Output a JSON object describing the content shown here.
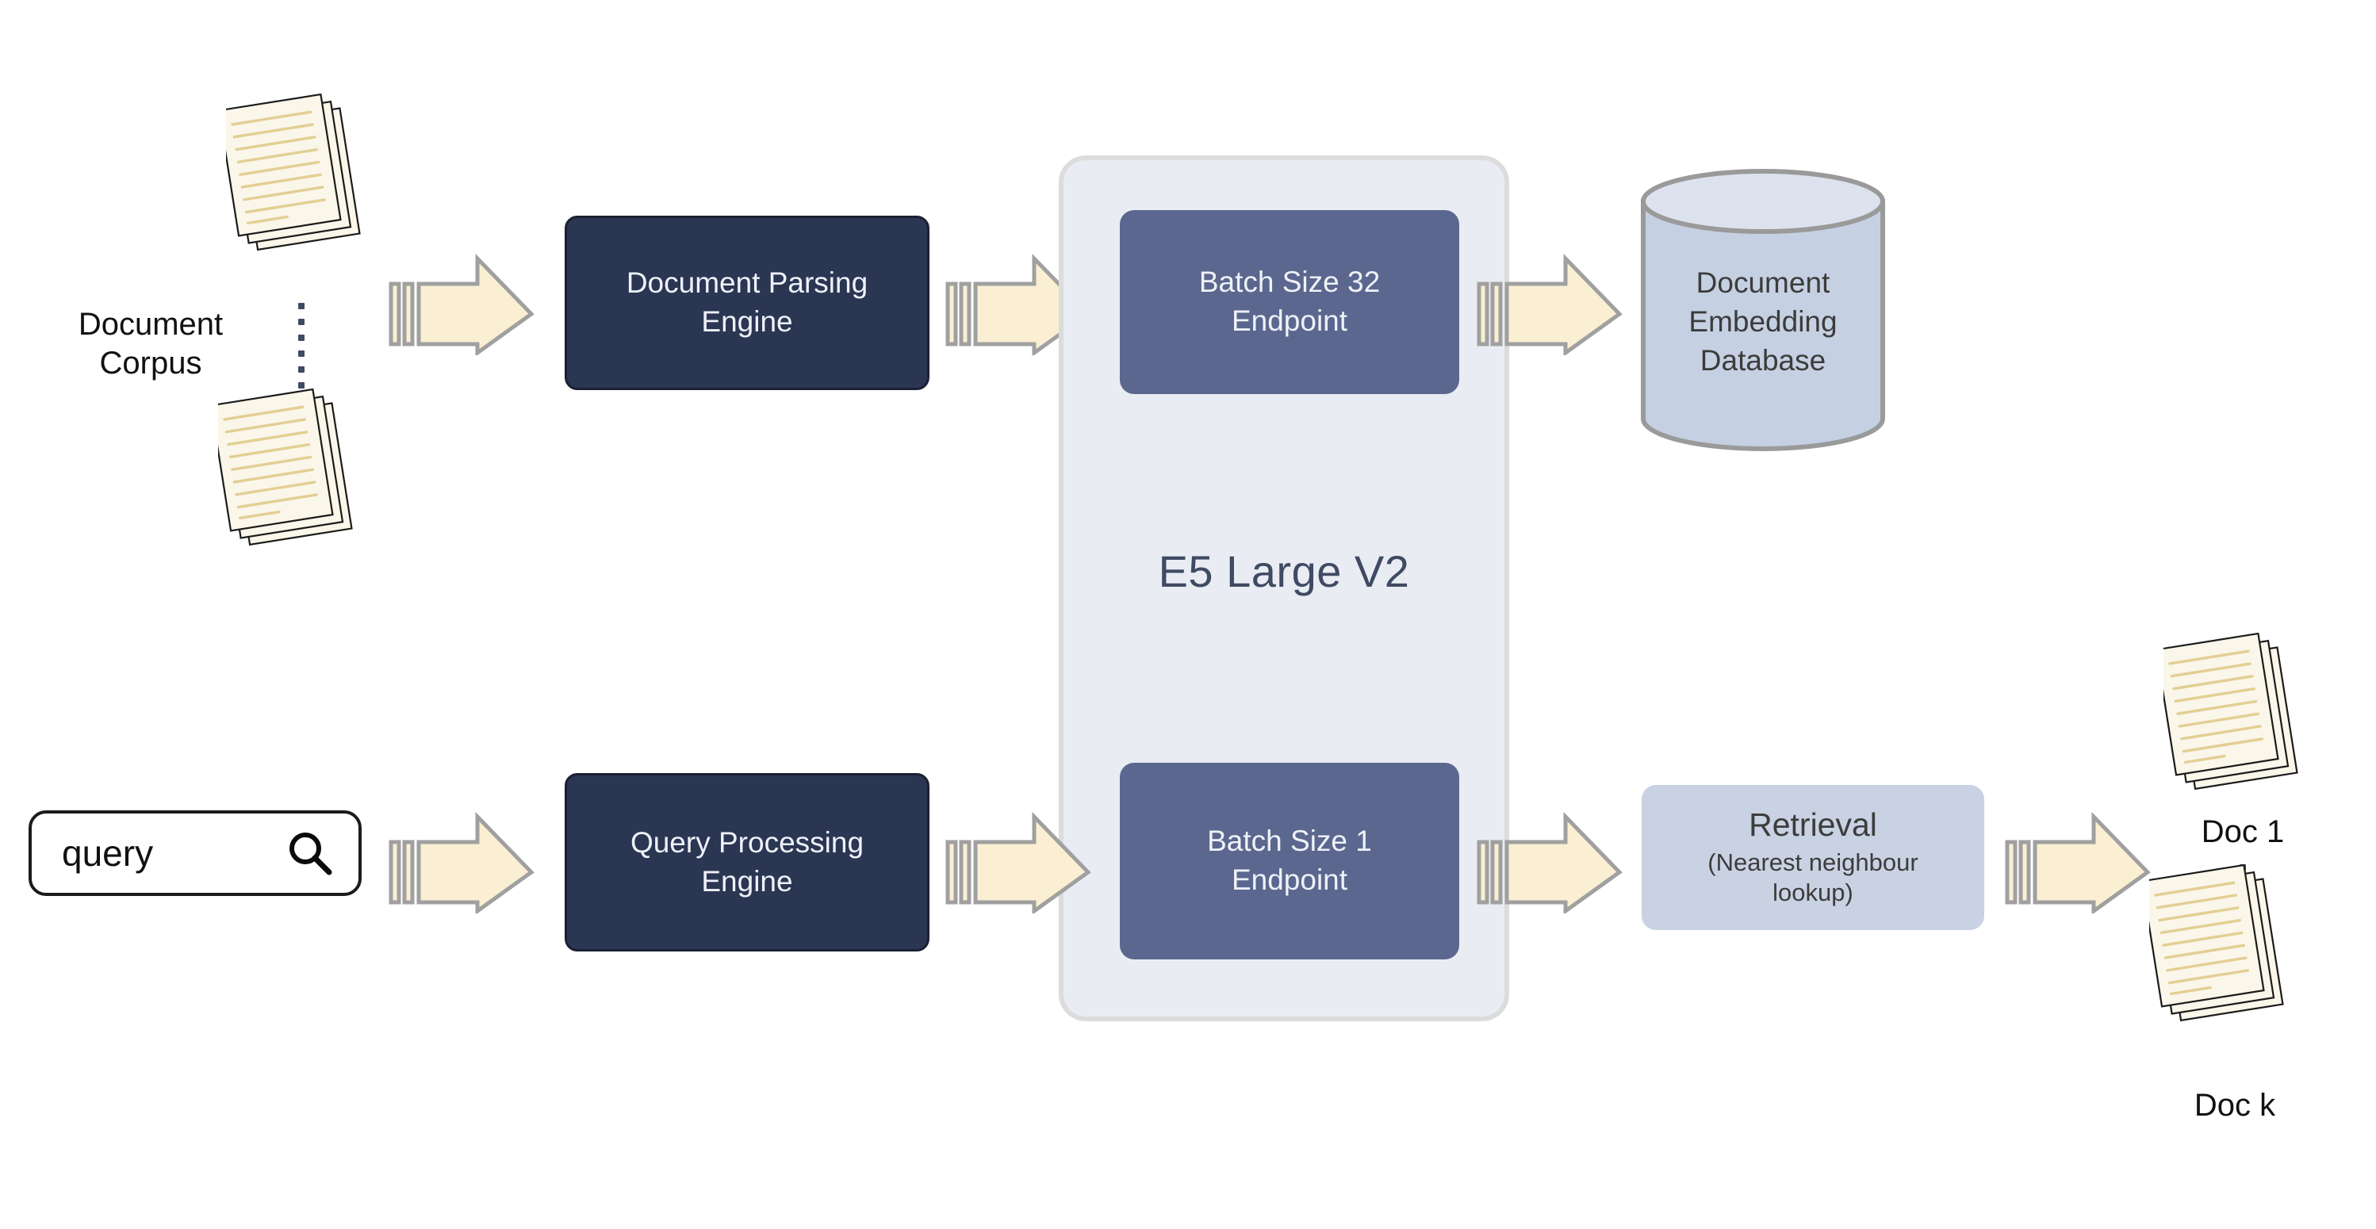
{
  "diagram": {
    "title": "E5 Large V2 document and query embedding retrieval pipeline",
    "colors": {
      "engine_box_fill": "#2b3653",
      "endpoint_box_fill": "#5b678e",
      "panel_fill": "#e9ecf2",
      "panel_border": "#dcdcdc",
      "cylinder_fill": "#c5d0e2",
      "cylinder_top_fill": "#dde3ee",
      "cylinder_border": "#9a9a9a",
      "retrieval_fill": "#c8d2e3",
      "arrow_fill": "#faefd2",
      "arrow_border": "#a0a0a0",
      "document_fill": "#faf6e9",
      "document_line": "#e2cf93",
      "document_border": "#1b1b1b",
      "text_dark": "#111111",
      "text_light": "#eef1f7",
      "e5_title_color": "#3f4a63"
    }
  },
  "corpus": {
    "label": "Document\nCorpus",
    "label_line_1": "Document",
    "label_line_2": "Corpus",
    "top_stack_name": "document-stack",
    "bottom_stack_name": "document-stack",
    "ellipsis": "vertical-dots"
  },
  "search": {
    "value": "query",
    "placeholder": "query",
    "icon": "search-icon"
  },
  "engines": {
    "document_parsing": {
      "line_1": "Document Parsing",
      "line_2": "Engine"
    },
    "query_processing": {
      "line_1": "Query Processing",
      "line_2": "Engine"
    }
  },
  "model_panel": {
    "title": "E5 Large V2",
    "endpoints": [
      {
        "line_1": "Batch Size 32",
        "line_2": "Endpoint"
      },
      {
        "line_1": "Batch Size 1",
        "line_2": "Endpoint"
      }
    ]
  },
  "database": {
    "line_1": "Document",
    "line_2": "Embedding",
    "line_3": "Database",
    "shape": "cylinder"
  },
  "retrieval": {
    "title": "Retrieval",
    "subtitle_line_1": "(Nearest neighbour",
    "subtitle_line_2": "lookup)"
  },
  "results": {
    "first_label": "Doc 1",
    "last_label": "Doc k",
    "ellipsis": "vertical-dots"
  },
  "arrows": [
    {
      "name": "arrow-corpus-to-parsing"
    },
    {
      "name": "arrow-parsing-to-batch32"
    },
    {
      "name": "arrow-batch32-to-database"
    },
    {
      "name": "arrow-query-to-processing"
    },
    {
      "name": "arrow-processing-to-batch1"
    },
    {
      "name": "arrow-batch1-to-retrieval"
    },
    {
      "name": "arrow-retrieval-to-docs"
    }
  ]
}
